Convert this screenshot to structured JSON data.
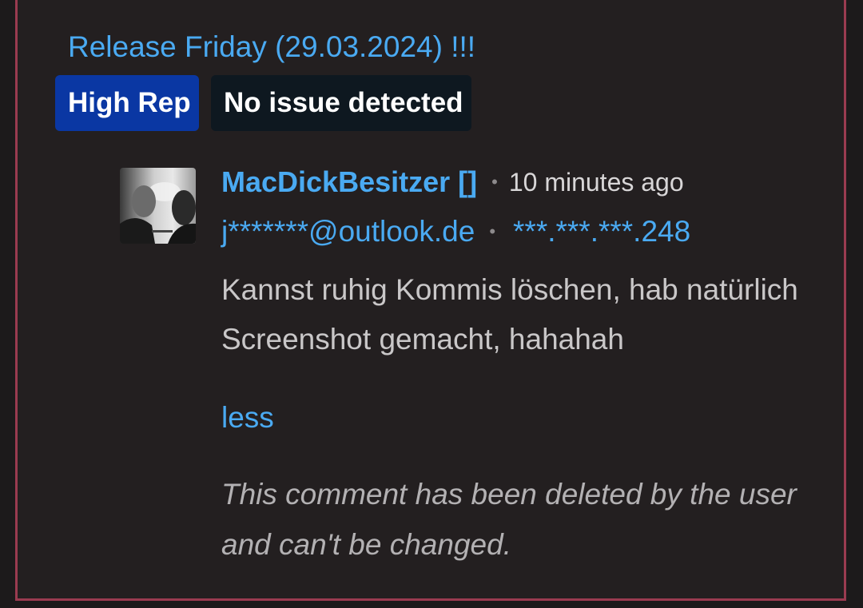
{
  "post": {
    "title": "Release Friday (29.03.2024) !!!",
    "badges": {
      "reputation": "High Rep",
      "status": "No issue detected"
    }
  },
  "comment": {
    "author": "MacDickBesitzer []",
    "time": "10 minutes ago",
    "email": "j*******@outlook.de",
    "ip": "***.***.***.248",
    "body": "Kannst ruhig Kommis löschen, hab natürlich Screenshot gemacht, hahahah",
    "toggle_label": "less",
    "deleted_notice": "This comment has been deleted by the user and can't be changed.",
    "separator": "•",
    "avatar_icon": "user-avatar-photo"
  },
  "colors": {
    "accent": "#4aaaf2",
    "border": "#9a3b50",
    "badge_rep": "#0a37a3",
    "badge_status": "#0e1820",
    "background": "#231f20"
  }
}
